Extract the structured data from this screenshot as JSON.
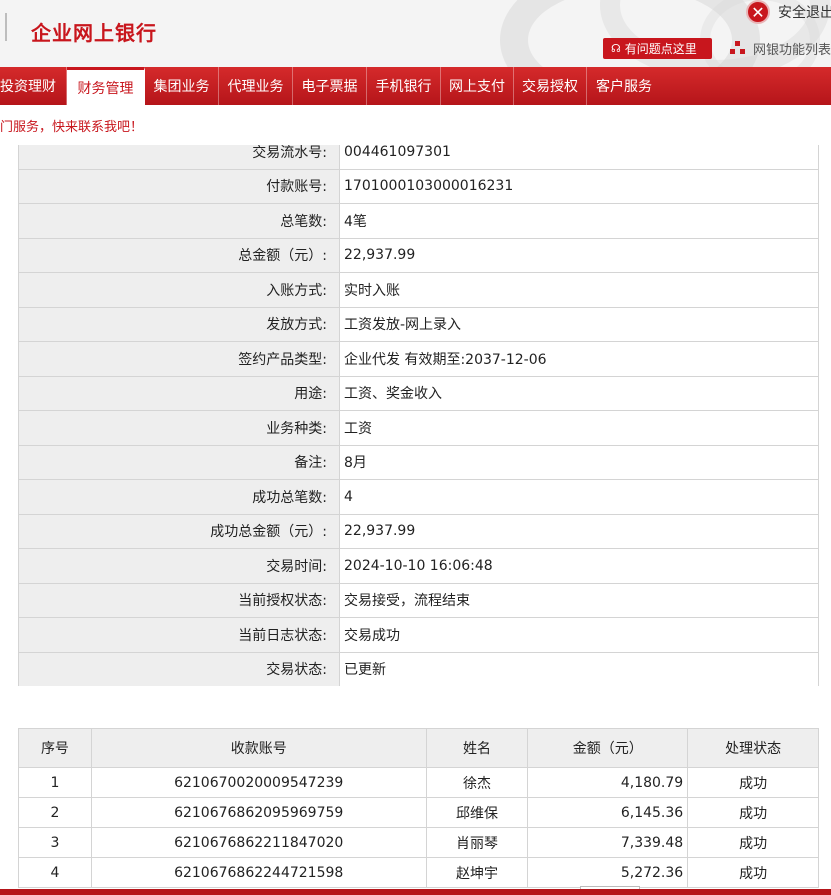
{
  "header": {
    "brand": "企业网上银行",
    "logout_label": "安全退出",
    "help_label": "有问题点这里",
    "sitemap_label": "网银功能列表"
  },
  "nav": {
    "items": [
      {
        "label": "投资理财"
      },
      {
        "label": "财务管理"
      },
      {
        "label": "集团业务"
      },
      {
        "label": "代理业务"
      },
      {
        "label": "电子票据"
      },
      {
        "label": "手机银行"
      },
      {
        "label": "网上支付"
      },
      {
        "label": "交易授权"
      },
      {
        "label": "客户服务"
      }
    ],
    "active_index": 1
  },
  "marquee": {
    "text": "门服务，快来联系我吧！"
  },
  "detail": {
    "rows": [
      {
        "label": "交易流水号:",
        "value": "004461097301"
      },
      {
        "label": "付款账号:",
        "value": "1701000103000016231"
      },
      {
        "label": "总笔数:",
        "value": "4笔"
      },
      {
        "label": "总金额（元）:",
        "value": "22,937.99"
      },
      {
        "label": "入账方式:",
        "value": "实时入账"
      },
      {
        "label": "发放方式:",
        "value": "工资发放-网上录入"
      },
      {
        "label": "签约产品类型:",
        "value": "企业代发 有效期至:2037-12-06"
      },
      {
        "label": "用途:",
        "value": "工资、奖金收入"
      },
      {
        "label": "业务种类:",
        "value": "工资"
      },
      {
        "label": "备注:",
        "value": "8月"
      },
      {
        "label": "成功总笔数:",
        "value": "4"
      },
      {
        "label": "成功总金额（元）:",
        "value": "22,937.99"
      },
      {
        "label": "交易时间:",
        "value": "2024-10-10 16:06:48"
      },
      {
        "label": "当前授权状态:",
        "value": "交易接受，流程结束"
      },
      {
        "label": "当前日志状态:",
        "value": "交易成功"
      },
      {
        "label": "交易状态:",
        "value": "已更新"
      }
    ]
  },
  "recipients": {
    "headers": [
      "序号",
      "收款账号",
      "姓名",
      "金额（元）",
      "处理状态"
    ],
    "rows": [
      {
        "seq": "1",
        "account": "6210670020009547239",
        "name": "徐杰",
        "amount": "4,180.79",
        "status": "成功"
      },
      {
        "seq": "2",
        "account": "6210676862095969759",
        "name": "邱维保",
        "amount": "6,145.36",
        "status": "成功"
      },
      {
        "seq": "3",
        "account": "6210676862211847020",
        "name": "肖丽琴",
        "amount": "7,339.48",
        "status": "成功"
      },
      {
        "seq": "4",
        "account": "6210676862244721598",
        "name": "赵坤宇",
        "amount": "5,272.36",
        "status": "成功"
      }
    ]
  },
  "colors": {
    "brand_red": "#c8161d",
    "label_bg": "#eeeeee",
    "border": "#d4d4d4"
  }
}
